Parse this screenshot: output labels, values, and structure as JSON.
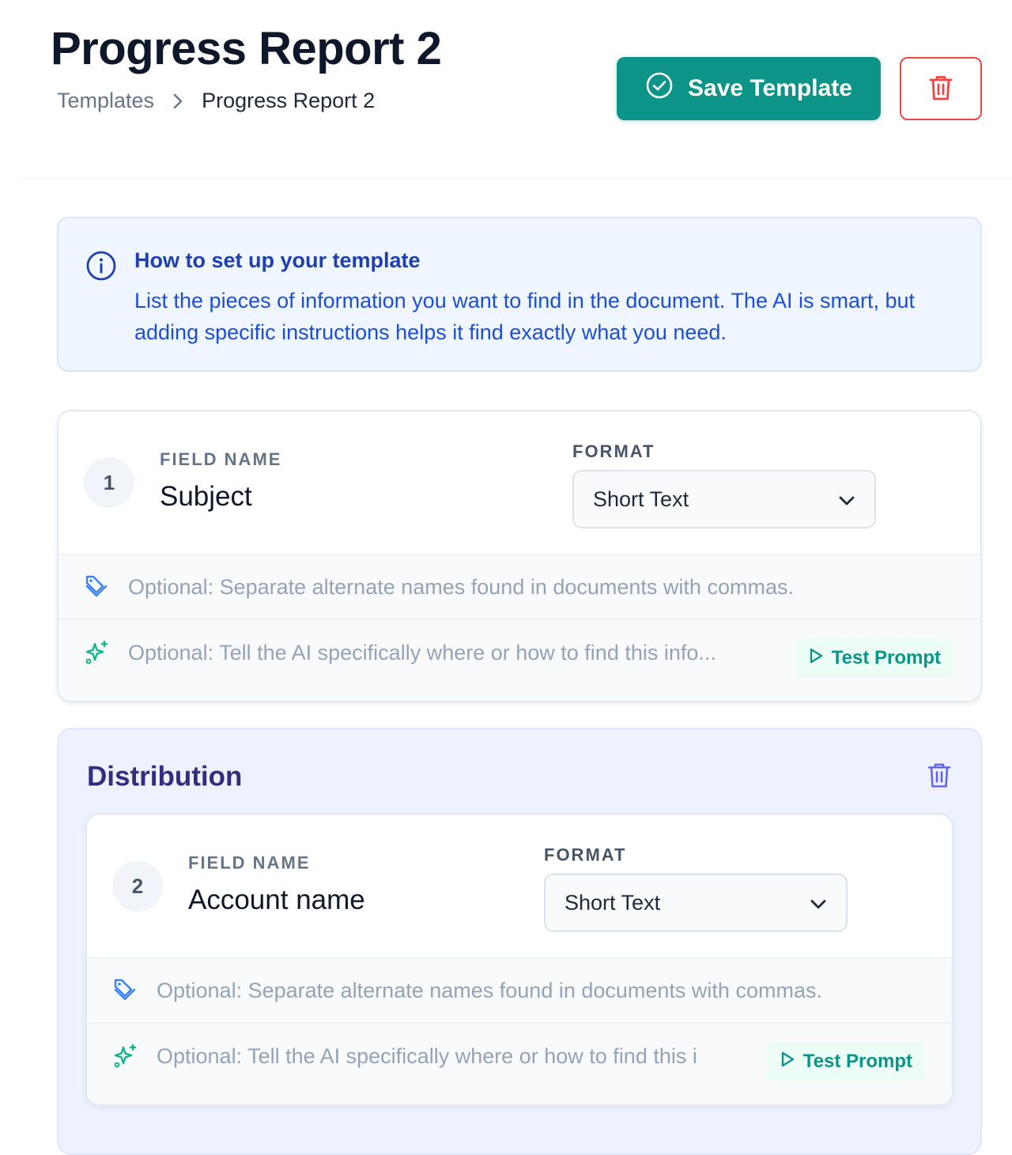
{
  "page": {
    "title": "Progress Report 2",
    "breadcrumb": {
      "parent": "Templates",
      "current": "Progress Report 2"
    }
  },
  "actions": {
    "save_label": "Save Template",
    "delete_icon": "trash-icon"
  },
  "info": {
    "title": "How to set up your template",
    "text": "List the pieces of information you want to find in the document. The AI is smart, but adding specific instructions helps it find exactly what you need."
  },
  "fields": [
    {
      "number": "1",
      "field_label": "FIELD NAME",
      "name": "Subject",
      "format_label": "FORMAT",
      "format": "Short Text",
      "aliases_placeholder": "Optional: Separate alternate names found in documents with commas.",
      "prompt_placeholder": "Optional: Tell the AI specifically where or how to find this info...",
      "test_label": "Test Prompt"
    }
  ],
  "section": {
    "title": "Distribution",
    "fields": [
      {
        "number": "2",
        "field_label": "FIELD NAME",
        "name": "Account name",
        "format_label": "FORMAT",
        "format": "Short Text",
        "aliases_placeholder": "Optional: Separate alternate names found in documents with commas.",
        "prompt_placeholder": "Optional: Tell the AI specifically where or how to find this i",
        "test_label": "Test Prompt"
      }
    ]
  },
  "colors": {
    "accent": "#0d9488",
    "danger": "#ef4444",
    "info_bg": "#eff6ff",
    "section_bg": "#eef2fe"
  }
}
